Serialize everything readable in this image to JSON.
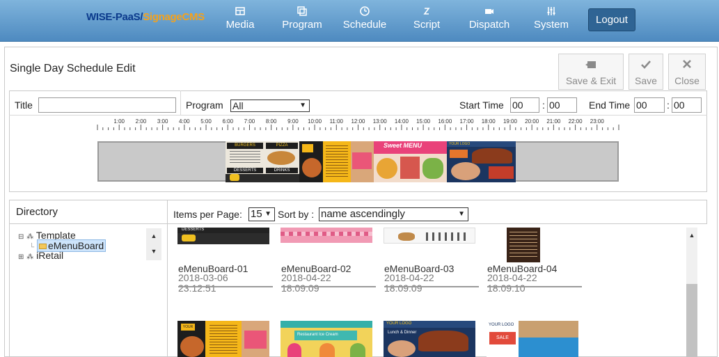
{
  "brand": {
    "part1": "WISE-PaaS/",
    "part2": "SignageCMS"
  },
  "nav": [
    {
      "label": "Media",
      "icon": "media-icon"
    },
    {
      "label": "Program",
      "icon": "program-icon"
    },
    {
      "label": "Schedule",
      "icon": "clock-icon"
    },
    {
      "label": "Script",
      "icon": "script-icon"
    },
    {
      "label": "Dispatch",
      "icon": "dispatch-icon"
    },
    {
      "label": "System",
      "icon": "system-icon"
    }
  ],
  "logout_label": "Logout",
  "page_title": "Single Day Schedule Edit",
  "toolbar": {
    "save_exit": "Save & Exit",
    "save": "Save",
    "close": "Close"
  },
  "form": {
    "title_label": "Title",
    "title_value": "",
    "program_label": "Program",
    "program_value": "All",
    "start_label": "Start Time",
    "start_h": "00",
    "start_m": "00",
    "end_label": "End Time",
    "end_h": "00",
    "end_m": "00",
    "time_sep": ":"
  },
  "timeline_hours": [
    "1:00",
    "2:00",
    "3:00",
    "4:00",
    "5:00",
    "6:00",
    "7:00",
    "8:00",
    "9:00",
    "10:00",
    "11:00",
    "12:00",
    "13:00",
    "14:00",
    "15:00",
    "16:00",
    "17:00",
    "18:00",
    "19:00",
    "20:00",
    "21:00",
    "22:00",
    "23:00"
  ],
  "directory": {
    "title": "Directory",
    "tree": [
      {
        "label": "Template",
        "expanded": true
      },
      {
        "label": "eMenuBoard",
        "selected": true
      },
      {
        "label": "iRetail",
        "expanded": false
      }
    ]
  },
  "list_controls": {
    "items_label": "Items per Page:",
    "items_value": "15",
    "sort_label": "Sort by :",
    "sort_value": "name ascendingly"
  },
  "cards": [
    {
      "name": "eMenuBoard-01",
      "date": "2018-03-06",
      "time": "23:12:51"
    },
    {
      "name": "eMenuBoard-02",
      "date": "2018-04-22",
      "time": "18:09:09"
    },
    {
      "name": "eMenuBoard-03",
      "date": "2018-04-22",
      "time": "18:09:09"
    },
    {
      "name": "eMenuBoard-04",
      "date": "2018-04-22",
      "time": "18:09:10"
    }
  ],
  "thumb_texts": {
    "desserts": "DESSERTS",
    "drinks": "DRINKS",
    "burgers": "BURGERS",
    "pizza": "PIZZA",
    "sweet_menu": "Sweet MENU",
    "your_logo": "YOUR LOGO",
    "lunch_dinner": "Lunch & Dinner",
    "restaurant": "Restaurant Ice Cream",
    "sale": "SALE"
  }
}
